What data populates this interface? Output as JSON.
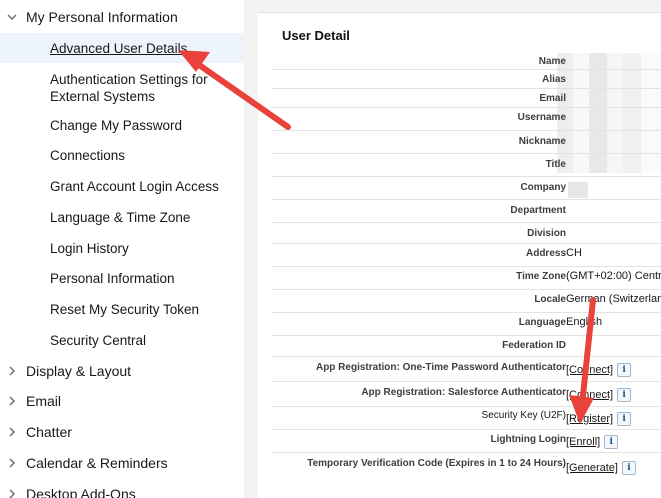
{
  "sidebar": {
    "personal_group": "My Personal Information",
    "items": [
      {
        "label": "Advanced User Details",
        "selected": true
      },
      {
        "label": "Authentication Settings for External Systems"
      },
      {
        "label": "Change My Password"
      },
      {
        "label": "Connections"
      },
      {
        "label": "Grant Account Login Access"
      },
      {
        "label": "Language & Time Zone"
      },
      {
        "label": "Login History"
      },
      {
        "label": "Personal Information"
      },
      {
        "label": "Reset My Security Token"
      },
      {
        "label": "Security Central"
      }
    ],
    "groups": [
      {
        "label": "Display & Layout"
      },
      {
        "label": "Email"
      },
      {
        "label": "Chatter"
      },
      {
        "label": "Calendar & Reminders"
      },
      {
        "label": "Desktop Add-Ons"
      }
    ]
  },
  "user_detail": {
    "title": "User Detail",
    "rows": [
      {
        "label": "Name",
        "value": ""
      },
      {
        "label": "Alias",
        "value": ""
      },
      {
        "label": "Email",
        "value": ""
      },
      {
        "label": "Username",
        "value": ""
      },
      {
        "label": "Nickname",
        "value": ""
      },
      {
        "label": "Title",
        "value": ""
      },
      {
        "label": "Company",
        "value": ""
      },
      {
        "label": "Department",
        "value": ""
      },
      {
        "label": "Division",
        "value": ""
      },
      {
        "label": "Address",
        "value": "CH"
      },
      {
        "label": "Time Zone",
        "value": "(GMT+02:00) Centr"
      },
      {
        "label": "Locale",
        "value": "German (Switzerlan"
      },
      {
        "label": "Language",
        "value": "English"
      },
      {
        "label": "Federation ID",
        "value": ""
      },
      {
        "label": "App Registration: One-Time Password Authenticator",
        "link": "[Connect]"
      },
      {
        "label": "App Registration: Salesforce Authenticator",
        "link": "[Connect]"
      },
      {
        "label": "Security Key (U2F)",
        "link": "[Register]"
      },
      {
        "label": "Lightning Login",
        "link": "[Enroll]"
      },
      {
        "label": "Temporary Verification Code (Expires in 1 to 24 Hours)",
        "link": "[Generate]"
      }
    ],
    "info_glyph": "i"
  },
  "annotation_color": "#e8423a"
}
